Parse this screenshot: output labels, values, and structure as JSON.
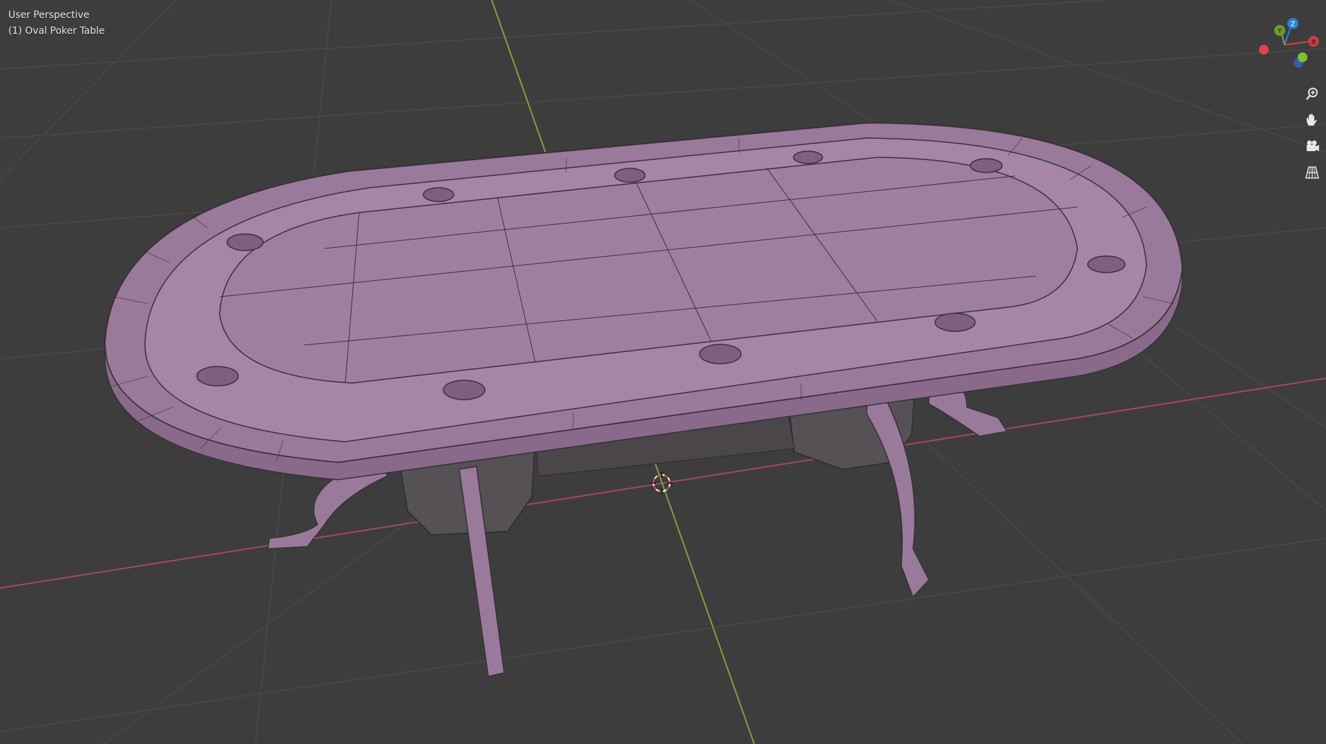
{
  "viewport": {
    "view_name": "User Perspective",
    "object_name": "(1) Oval Poker Table"
  },
  "nav_gizmo": {
    "axis_z": "Z",
    "axis_y": "Y",
    "axis_x": "X"
  },
  "colors": {
    "background": "#3d3d3d",
    "grid": "#4a4a4a",
    "x_axis": "#a84a55",
    "y_axis": "#79a53c",
    "mesh_fill": "#9a7a9a",
    "mesh_edge": "#3a2f3a",
    "dark_mesh": "#555155"
  },
  "nav_buttons": [
    {
      "icon": "zoom-icon"
    },
    {
      "icon": "hand-pan-icon"
    },
    {
      "icon": "camera-icon"
    },
    {
      "icon": "grid-perspective-icon"
    }
  ]
}
